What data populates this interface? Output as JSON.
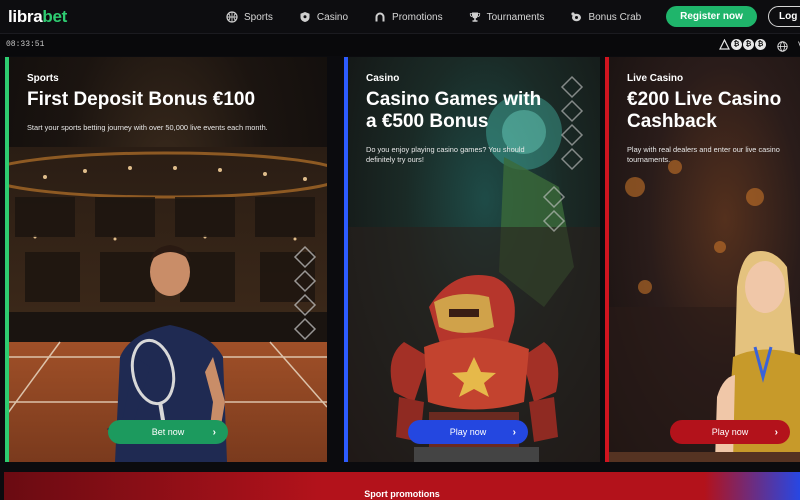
{
  "header": {
    "logo_prefix": "libra",
    "logo_suffix": "bet",
    "nav": [
      {
        "label": "Sports",
        "icon": "basketball-icon"
      },
      {
        "label": "Casino",
        "icon": "shield-casino-icon"
      },
      {
        "label": "Promotions",
        "icon": "horseshoe-icon"
      },
      {
        "label": "Tournaments",
        "icon": "trophy-icon"
      },
      {
        "label": "Bonus Crab",
        "icon": "crab-icon"
      }
    ],
    "register_label": "Register now",
    "login_label": "Log"
  },
  "subbar": {
    "time": "08:33:51",
    "currency_icons": [
      "₿",
      "₿",
      "₿"
    ],
    "lang": "V"
  },
  "cards": [
    {
      "category": "Sports",
      "title": "First Deposit Bonus €100",
      "description": "Start your sports betting journey with over 50,000 live events each month.",
      "cta": "Bet now",
      "accent": "#2ecc71",
      "cta_color": "#1c9a5e"
    },
    {
      "category": "Casino",
      "title_line1": "Casino Games with",
      "title_line2": "a €500 Bonus",
      "description_line1": "Do you enjoy playing casino games? You should",
      "description_line2": "definitely try ours!",
      "cta": "Play now",
      "accent": "#2d5cff",
      "cta_color": "#2447e0"
    },
    {
      "category": "Live Casino",
      "title_line1": "€200 Live Casino",
      "title_line2": "Cashback",
      "description_line1": "Play with real dealers and enter our live casino",
      "description_line2": "tournaments.",
      "cta": "Play now",
      "accent": "#d0141f",
      "cta_color": "#b3121b"
    }
  ],
  "footer": {
    "label": "Sport promotions"
  }
}
